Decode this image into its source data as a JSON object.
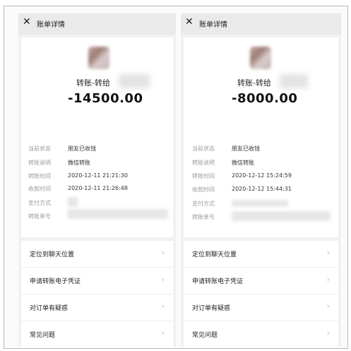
{
  "left": {
    "header_title": "账单详情",
    "close_icon": "✕",
    "name": "转账-转给",
    "amount": "-14500.00",
    "details": [
      {
        "key": "当前状态",
        "value": "朋友已收钱"
      },
      {
        "key": "转账说明",
        "value": "微信转账"
      },
      {
        "key": "转账时间",
        "value": "2020-12-11 21:21:30"
      },
      {
        "key": "收款时间",
        "value": "2020-12-11 21:26:48"
      },
      {
        "key": "支付方式",
        "value": ""
      },
      {
        "key": "转账单号",
        "value": ""
      }
    ],
    "menu": [
      "定位到聊天位置",
      "申请转账电子凭证",
      "对订单有疑惑",
      "常见问题"
    ]
  },
  "right": {
    "header_title": "账单详情",
    "close_icon": "✕",
    "name": "转账-转给",
    "amount": "-8000.00",
    "details": [
      {
        "key": "当前状态",
        "value": "朋友已收钱"
      },
      {
        "key": "转账说明",
        "value": "微信转账"
      },
      {
        "key": "转账时间",
        "value": "2020-12-12 15:24:59"
      },
      {
        "key": "收款时间",
        "value": "2020-12-12 15:44:31"
      },
      {
        "key": "支付方式",
        "value": ""
      },
      {
        "key": "转账单号",
        "value": ""
      }
    ],
    "menu": [
      "定位到聊天位置",
      "申请转账电子凭证",
      "对订单有疑惑",
      "常见问题"
    ]
  },
  "icons": {
    "close": "close-icon",
    "chevron": "chevron-right-icon"
  },
  "chevron_glyph": "›"
}
